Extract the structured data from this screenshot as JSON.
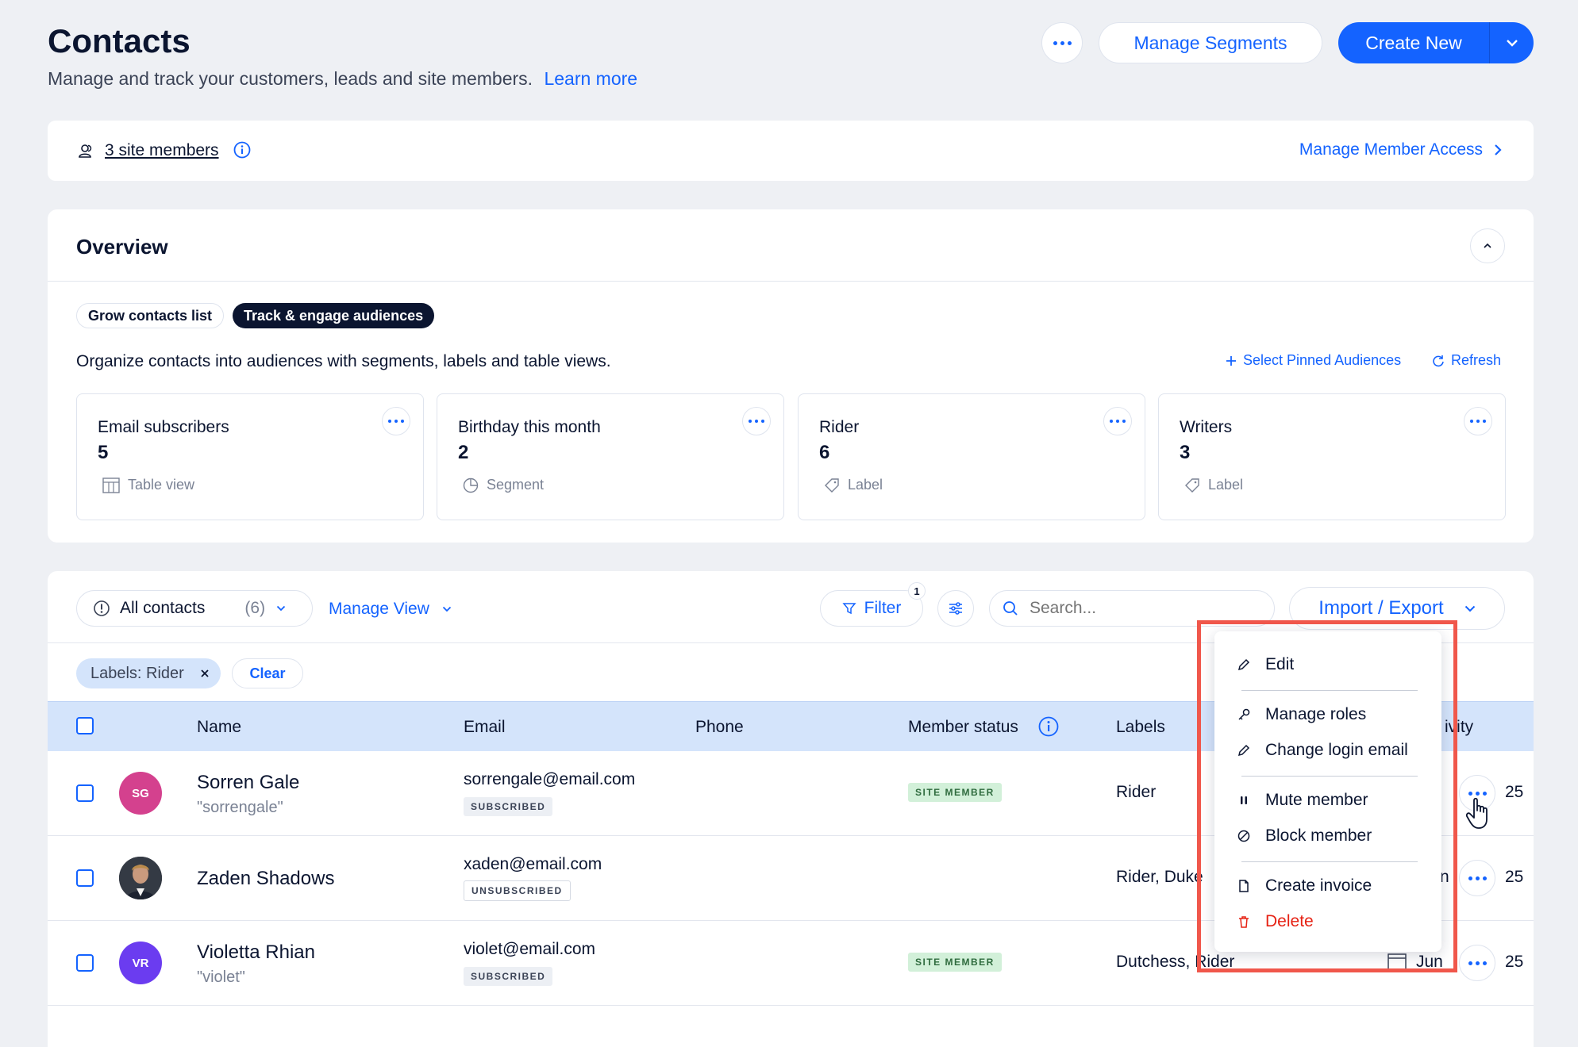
{
  "header": {
    "title": "Contacts",
    "subtitle": "Manage and track your customers, leads and site members.",
    "learn_more": "Learn more",
    "manage_segments": "Manage Segments",
    "create_new": "Create New"
  },
  "members_bar": {
    "members_link": "3 site members",
    "manage_access": "Manage Member Access"
  },
  "overview": {
    "title": "Overview",
    "tabs": [
      "Grow contacts list",
      "Track & engage audiences"
    ],
    "description": "Organize contacts into audiences with segments, labels and table views.",
    "select_pinned": "Select Pinned Audiences",
    "refresh": "Refresh",
    "audiences": [
      {
        "title": "Email subscribers",
        "count": "5",
        "type": "Table view"
      },
      {
        "title": "Birthday this month",
        "count": "2",
        "type": "Segment"
      },
      {
        "title": "Rider",
        "count": "6",
        "type": "Label"
      },
      {
        "title": "Writers",
        "count": "3",
        "type": "Label"
      }
    ]
  },
  "toolbar": {
    "view": "All contacts",
    "view_count": "(6)",
    "manage_view": "Manage View",
    "filter": "Filter",
    "filter_count": "1",
    "search_placeholder": "Search...",
    "import_export": "Import / Export"
  },
  "active_filter": {
    "label": "Labels: Rider",
    "clear": "Clear"
  },
  "table": {
    "columns": [
      "Name",
      "Email",
      "Phone",
      "Member status",
      "Labels",
      "ivity"
    ],
    "rows": [
      {
        "initials": "SG",
        "name": "Sorren Gale",
        "nickname": "\"sorrengale\"",
        "email": "sorrengale@email.com",
        "email_status": "SUBSCRIBED",
        "member_status": "SITE MEMBER",
        "labels": "Rider",
        "activity": "25"
      },
      {
        "initials": "",
        "name": "Zaden Shadows",
        "nickname": "",
        "email": "xaden@email.com",
        "email_status": "UNSUBSCRIBED",
        "member_status": "",
        "labels": "Rider, Duke",
        "activity_partial": "n",
        "activity": "25"
      },
      {
        "initials": "VR",
        "name": "Violetta Rhian",
        "nickname": "\"violet\"",
        "email": "violet@email.com",
        "email_status": "SUBSCRIBED",
        "member_status": "SITE MEMBER",
        "labels": "Dutchess, Rider",
        "activity_partial": "Jun",
        "activity": "25"
      }
    ]
  },
  "context_menu": {
    "items": [
      "Edit",
      "Manage roles",
      "Change login email",
      "Mute member",
      "Block member",
      "Create invoice",
      "Delete"
    ]
  },
  "colors": {
    "accent": "#1463ff",
    "delete": "#e62214",
    "highlight_box": "#f0574b",
    "table_header": "#d4e4fb",
    "avatar_sg": "#d4418e",
    "avatar_vr": "#6b3cf0"
  }
}
